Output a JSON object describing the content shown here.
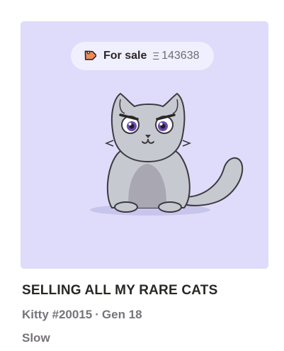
{
  "card": {
    "background_color": "#dedcfa",
    "sale_tag": {
      "icon": "price-tag-icon",
      "label": "For sale",
      "currency_symbol": "Ξ",
      "price": "143638"
    },
    "kitty_name": "SELLING ALL MY RARE CATS",
    "kitty_id": "Kitty #20015",
    "separator": "·",
    "generation": "Gen 18",
    "cooldown": "Slow"
  }
}
